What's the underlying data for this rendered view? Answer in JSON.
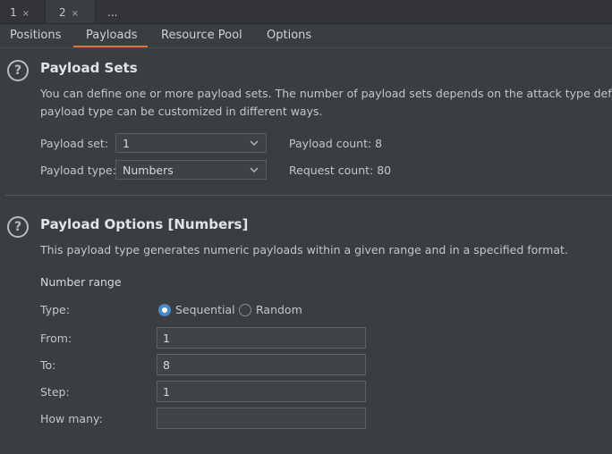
{
  "top_tabs": [
    {
      "label": "1",
      "close": "×"
    },
    {
      "label": "2",
      "close": "×"
    },
    {
      "label": "..."
    }
  ],
  "sub_tabs": [
    "Positions",
    "Payloads",
    "Resource Pool",
    "Options"
  ],
  "active_sub_tab": "Payloads",
  "payload_sets": {
    "help": "?",
    "title": "Payload Sets",
    "description_line1": "You can define one or more payload sets. The number of payload sets depends on the attack type defin",
    "description_line2": "payload type can be customized in different ways.",
    "payload_set_label": "Payload set:",
    "payload_set_value": "1",
    "payload_type_label": "Payload type:",
    "payload_type_value": "Numbers",
    "payload_count": "Payload count: 8",
    "request_count": "Request count: 80"
  },
  "payload_options": {
    "help": "?",
    "title": "Payload Options [Numbers]",
    "description": "This payload type generates numeric payloads within a given range and in a specified format.",
    "number_range_label": "Number range",
    "type_label": "Type:",
    "type_options": [
      "Sequential",
      "Random"
    ],
    "type_selected": "Sequential",
    "from_label": "From:",
    "from_value": "1",
    "to_label": "To:",
    "to_value": "8",
    "step_label": "Step:",
    "step_value": "1",
    "how_many_label": "How many:",
    "how_many_value": ""
  },
  "colors": {
    "background": "#3b3e41",
    "accent": "#e0703c",
    "radio_selected": "#4a88c7"
  }
}
